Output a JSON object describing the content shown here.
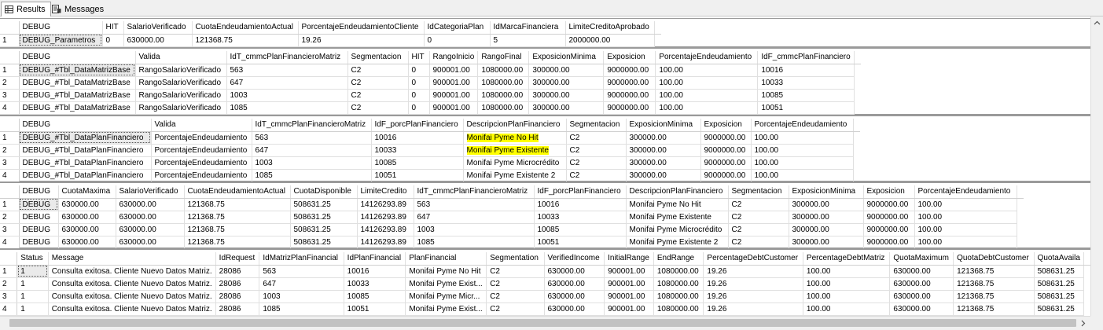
{
  "tabs": [
    {
      "label": "Results",
      "icon": "grid-results-icon",
      "active": true
    },
    {
      "label": "Messages",
      "icon": "messages-icon",
      "active": false
    }
  ],
  "grids": [
    {
      "columns": [
        "DEBUG",
        "HIT",
        "SalarioVerificado",
        "CuotaEndeudamientoActual",
        "PorcentajeEndeudamientoCliente",
        "IdCategoriaPlan",
        "IdMarcaFinanciera",
        "LimiteCreditoAprobado"
      ],
      "rows": [
        [
          "DEBUG_Parametros",
          "0",
          "630000.00",
          "121368.75",
          "19.26",
          "0",
          "5",
          "2000000.00"
        ]
      ]
    },
    {
      "columns": [
        "DEBUG",
        "Valida",
        "IdT_cmmcPlanFinancieroMatriz",
        "Segmentacion",
        "HIT",
        "RangoInicio",
        "RangoFinal",
        "ExposicionMinima",
        "Exposicion",
        "PorcentajeEndeudamiento",
        "IdF_cmmcPlanFinanciero"
      ],
      "rows": [
        [
          "DEBUG_#Tbl_DataMatrizBase",
          "RangoSalarioVerificado",
          "563",
          "C2",
          "0",
          "900001.00",
          "1080000.00",
          "300000.00",
          "9000000.00",
          "100.00",
          "10016"
        ],
        [
          "DEBUG_#Tbl_DataMatrizBase",
          "RangoSalarioVerificado",
          "647",
          "C2",
          "0",
          "900001.00",
          "1080000.00",
          "300000.00",
          "9000000.00",
          "100.00",
          "10033"
        ],
        [
          "DEBUG_#Tbl_DataMatrizBase",
          "RangoSalarioVerificado",
          "1003",
          "C2",
          "0",
          "900001.00",
          "1080000.00",
          "300000.00",
          "9000000.00",
          "100.00",
          "10085"
        ],
        [
          "DEBUG_#Tbl_DataMatrizBase",
          "RangoSalarioVerificado",
          "1085",
          "C2",
          "0",
          "900001.00",
          "1080000.00",
          "300000.00",
          "9000000.00",
          "100.00",
          "10051"
        ]
      ]
    },
    {
      "columns": [
        "DEBUG",
        "Valida",
        "IdT_cmmcPlanFinancieroMatriz",
        "IdF_porcPlanFinanciero",
        "DescripcionPlanFinanciero",
        "Segmentacion",
        "ExposicionMinima",
        "Exposicion",
        "PorcentajeEndeudamiento"
      ],
      "rows": [
        [
          "DEBUG_#Tbl_DataPlanFinanciero",
          "PorcentajeEndeudamiento",
          "563",
          "10016",
          "Monifai Pyme No Hit",
          "C2",
          "300000.00",
          "9000000.00",
          "100.00"
        ],
        [
          "DEBUG_#Tbl_DataPlanFinanciero",
          "PorcentajeEndeudamiento",
          "647",
          "10033",
          "Monifai Pyme Existente",
          "C2",
          "300000.00",
          "9000000.00",
          "100.00"
        ],
        [
          "DEBUG_#Tbl_DataPlanFinanciero",
          "PorcentajeEndeudamiento",
          "1003",
          "10085",
          "Monifai Pyme Microcrédito",
          "C2",
          "300000.00",
          "9000000.00",
          "100.00"
        ],
        [
          "DEBUG_#Tbl_DataPlanFinanciero",
          "PorcentajeEndeudamiento",
          "1085",
          "10051",
          "Monifai Pyme Existente 2",
          "C2",
          "300000.00",
          "9000000.00",
          "100.00"
        ]
      ]
    },
    {
      "columns": [
        "DEBUG",
        "CuotaMaxima",
        "SalarioVerificado",
        "CuotaEndeudamientoActual",
        "CuotaDisponible",
        "LimiteCredito",
        "IdT_cmmcPlanFinancieroMatriz",
        "IdF_porcPlanFinanciero",
        "DescripcionPlanFinanciero",
        "Segmentacion",
        "ExposicionMinima",
        "Exposicion",
        "PorcentajeEndeudamiento"
      ],
      "rows": [
        [
          "DEBUG",
          "630000.00",
          "630000.00",
          "121368.75",
          "508631.25",
          "14126293.89",
          "563",
          "10016",
          "Monifai Pyme No Hit",
          "C2",
          "300000.00",
          "9000000.00",
          "100.00"
        ],
        [
          "DEBUG",
          "630000.00",
          "630000.00",
          "121368.75",
          "508631.25",
          "14126293.89",
          "647",
          "10033",
          "Monifai Pyme Existente",
          "C2",
          "300000.00",
          "9000000.00",
          "100.00"
        ],
        [
          "DEBUG",
          "630000.00",
          "630000.00",
          "121368.75",
          "508631.25",
          "14126293.89",
          "1003",
          "10085",
          "Monifai Pyme Microcrédito",
          "C2",
          "300000.00",
          "9000000.00",
          "100.00"
        ],
        [
          "DEBUG",
          "630000.00",
          "630000.00",
          "121368.75",
          "508631.25",
          "14126293.89",
          "1085",
          "10051",
          "Monifai Pyme Existente 2",
          "C2",
          "300000.00",
          "9000000.00",
          "100.00"
        ]
      ]
    },
    {
      "columns": [
        "Status",
        "Message",
        "IdRequest",
        "IdMatrizPlanFinancial",
        "IdPlanFinancial",
        "PlanFinancial",
        "Segmentation",
        "VerifiedIncome",
        "InitialRange",
        "EndRange",
        "PercentageDebtCustomer",
        "PercentageDebtMatriz",
        "QuotaMaximum",
        "QuotaDebtCustomer",
        "QuotaAvaila"
      ],
      "rows": [
        [
          "1",
          "Consulta exitosa. Cliente Nuevo Datos Matriz.",
          "28086",
          "563",
          "10016",
          "Monifai Pyme No Hit",
          "C2",
          "630000.00",
          "900001.00",
          "1080000.00",
          "19.26",
          "100.00",
          "630000.00",
          "121368.75",
          "508631.25"
        ],
        [
          "1",
          "Consulta exitosa. Cliente Nuevo Datos Matriz.",
          "28086",
          "647",
          "10033",
          "Monifai Pyme Exist...",
          "C2",
          "630000.00",
          "900001.00",
          "1080000.00",
          "19.26",
          "100.00",
          "630000.00",
          "121368.75",
          "508631.25"
        ],
        [
          "1",
          "Consulta exitosa. Cliente Nuevo Datos Matriz.",
          "28086",
          "1003",
          "10085",
          "Monifai Pyme Micr...",
          "C2",
          "630000.00",
          "900001.00",
          "1080000.00",
          "19.26",
          "100.00",
          "630000.00",
          "121368.75",
          "508631.25"
        ],
        [
          "1",
          "Consulta exitosa. Cliente Nuevo Datos Matriz.",
          "28086",
          "1085",
          "10051",
          "Monifai Pyme Exist...",
          "C2",
          "630000.00",
          "900001.00",
          "1080000.00",
          "19.26",
          "100.00",
          "630000.00",
          "121368.75",
          "508631.25"
        ]
      ]
    }
  ],
  "highlight_color": "#ffff00",
  "selection_border": "#555555"
}
